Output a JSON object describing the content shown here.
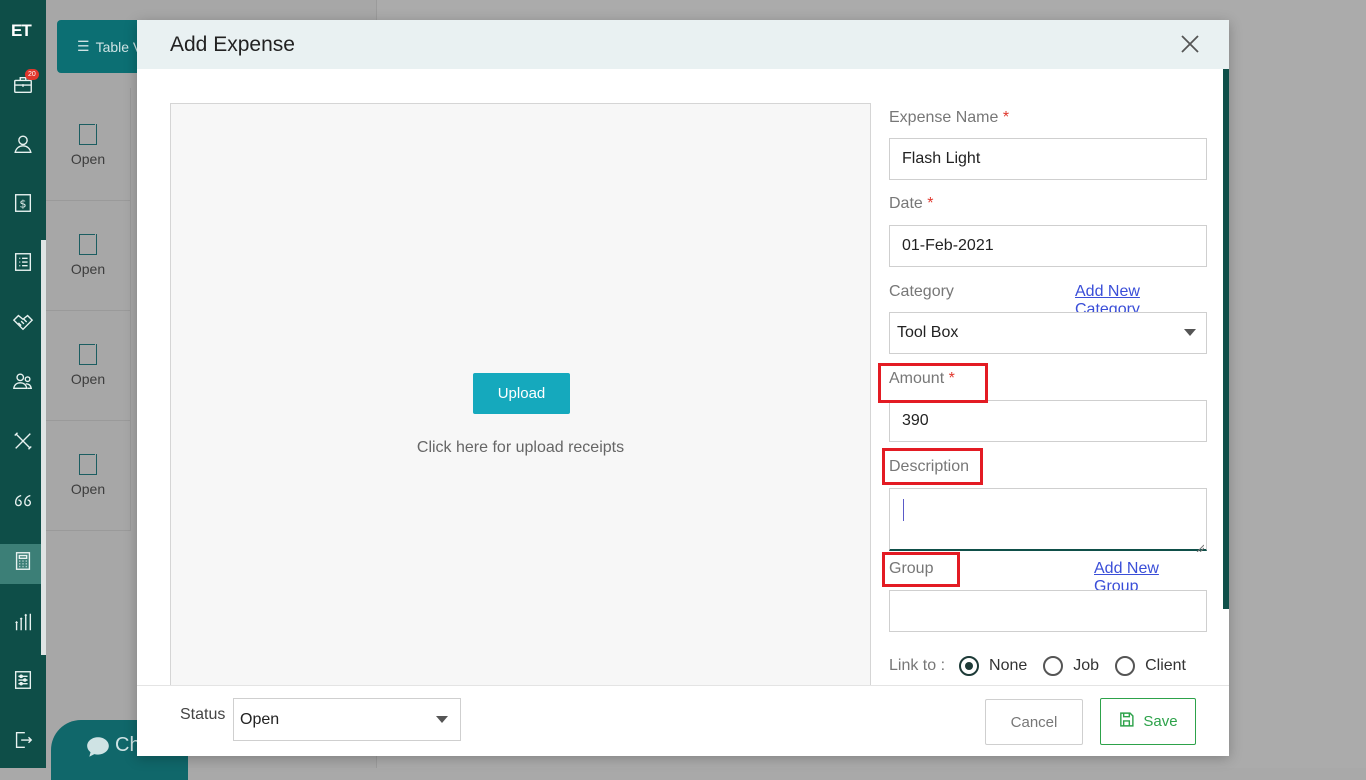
{
  "app": {
    "logo_text": "ET",
    "notification_count": "20",
    "table_view_label": "Table V",
    "chat_label": "Ch",
    "rows": [
      {
        "status": "Open"
      },
      {
        "status": "Open"
      },
      {
        "status": "Open"
      },
      {
        "status": "Open"
      }
    ]
  },
  "modal": {
    "title": "Add Expense",
    "upload": {
      "button_label": "Upload",
      "hint": "Click here for upload receipts"
    },
    "form": {
      "expense_name": {
        "label": "Expense Name",
        "required": "*",
        "value": "Flash Light"
      },
      "date": {
        "label": "Date",
        "required": "*",
        "value": "01-Feb-2021"
      },
      "category": {
        "label": "Category",
        "value": "Tool Box",
        "add_link": "Add New Category"
      },
      "amount": {
        "label": "Amount",
        "required": "*",
        "value": "390"
      },
      "description": {
        "label": "Description",
        "value": ""
      },
      "group": {
        "label": "Group",
        "value": "",
        "add_link": "Add New Group"
      },
      "link_to": {
        "label": "Link to :",
        "options": [
          "None",
          "Job",
          "Client"
        ],
        "selected": "None"
      }
    },
    "footer": {
      "status_label": "Status",
      "status_value": "Open",
      "cancel_label": "Cancel",
      "save_label": "Save"
    }
  },
  "colors": {
    "sidebar": "#0e4e48",
    "upload_button": "#15a9bd",
    "save_green": "#2da24a",
    "highlight_red": "#e31b23",
    "link_blue": "#3a4ed8"
  }
}
